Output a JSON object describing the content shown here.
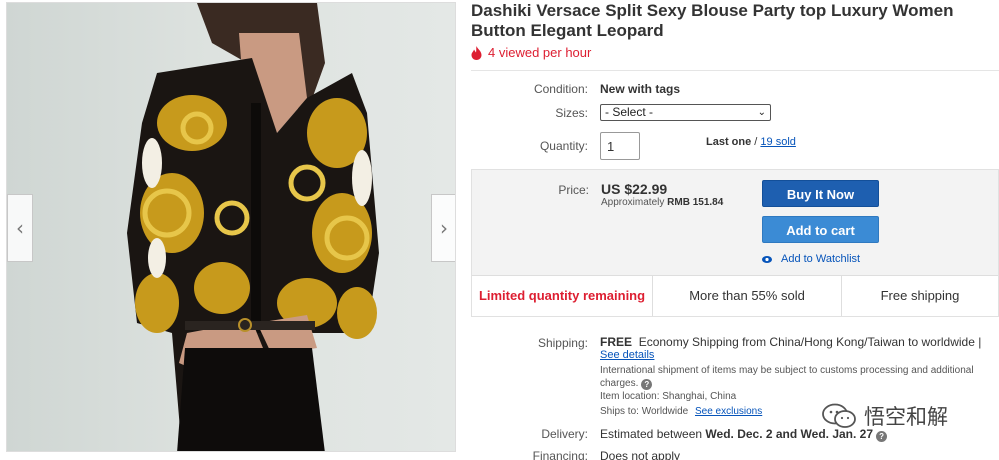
{
  "listing": {
    "title": "Dashiki Versace Split Sexy Blouse Party top Luxury Women Button Elegant Leopard",
    "viewed": "4 viewed per hour"
  },
  "gallery": {
    "prev": "‹",
    "next": "›"
  },
  "condition": {
    "label": "Condition:",
    "value": "New with tags"
  },
  "sizes": {
    "label": "Sizes:",
    "selected": "- Select -"
  },
  "quantity": {
    "label": "Quantity:",
    "value": "1",
    "last_one": "Last one",
    "separator": " / ",
    "sold": "19 sold"
  },
  "price": {
    "label": "Price:",
    "value": "US $22.99",
    "approx_prefix": "Approximately",
    "approx_value": "RMB 151.84",
    "buy_now": "Buy It Now",
    "add_to_cart": "Add to cart",
    "watchlist": "Add to Watchlist"
  },
  "highlights": {
    "limited": "Limited quantity remaining",
    "sold_pct": "More than 55% sold",
    "free_ship": "Free shipping"
  },
  "shipping": {
    "label": "Shipping:",
    "free": "FREE",
    "description": "Economy Shipping from China/Hong Kong/Taiwan to worldwide |",
    "see_details": "See details",
    "intl_note": "International shipment of items may be subject to customs processing and additional charges.",
    "item_location_label": "Item location:",
    "item_location": "Shanghai, China",
    "ships_to_label": "Ships to:",
    "ships_to": "Worldwide",
    "see_exclusions": "See exclusions"
  },
  "delivery": {
    "label": "Delivery:",
    "prefix": "Estimated between",
    "dates": "Wed. Dec. 2 and Wed. Jan. 27"
  },
  "financing": {
    "label": "Financing:",
    "value": "Does not apply"
  },
  "watermark": {
    "text": "悟空和解"
  },
  "colors": {
    "accent_blue": "#1e5fb0",
    "link_blue": "#0654ba",
    "alert_red": "#dd1e31"
  }
}
